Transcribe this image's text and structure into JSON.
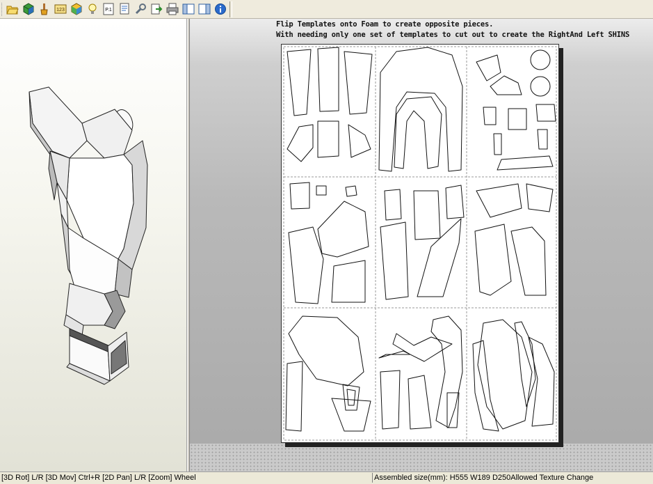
{
  "toolbar": {
    "buttons": [
      {
        "name": "open-folder-icon"
      },
      {
        "name": "cube-icon"
      },
      {
        "name": "brush-icon"
      },
      {
        "name": "numbered-parts-icon"
      },
      {
        "name": "texture-cube-icon"
      },
      {
        "name": "light-bulb-icon"
      },
      {
        "name": "page-icon"
      },
      {
        "name": "page-number-icon"
      },
      {
        "name": "fold-line-icon"
      },
      {
        "name": "wrench-icon"
      },
      {
        "name": "export-icon"
      },
      {
        "name": "printer-icon"
      },
      {
        "name": "panel-left-icon"
      },
      {
        "name": "panel-right-icon"
      },
      {
        "name": "info-icon"
      }
    ],
    "p1_label": "P.1"
  },
  "notes": {
    "line1": "Flip Templates onto Foam to create opposite pieces.",
    "line2": "With needing only one set of templates to cut out to create the RightAnd Left SHINS"
  },
  "status": {
    "controls": "[3D Rot] L/R [3D Mov] Ctrl+R [2D Pan] L/R [Zoom] Wheel",
    "assembled": "Assembled size(mm): H555 W189 D250Allowed Texture Change"
  },
  "colors": {
    "toolbar_bg": "#efebdd",
    "status_bg": "#ece9d8"
  }
}
